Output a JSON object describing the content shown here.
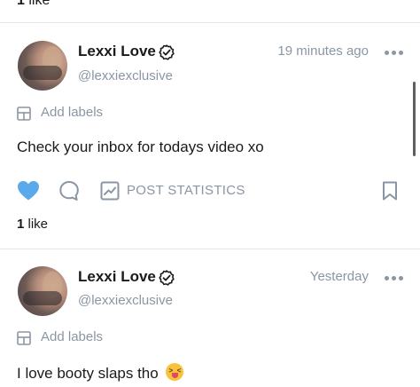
{
  "feed": {
    "previous_post_likes": {
      "count": "1",
      "label": "like"
    },
    "posts": [
      {
        "author_name": "Lexxi Love",
        "handle": "@lexxiexclusive",
        "time": "19 minutes ago",
        "add_labels": "Add labels",
        "text": "Check your inbox for todays video xo",
        "liked": true,
        "stats_label": "POST STATISTICS",
        "likes_count": "1",
        "likes_label": "like"
      },
      {
        "author_name": "Lexxi Love",
        "handle": "@lexxiexclusive",
        "time": "Yesterday",
        "add_labels": "Add labels",
        "text": "I love booty slaps tho",
        "emoji": "squinting-face-with-tongue"
      }
    ]
  },
  "colors": {
    "accent_blue": "#5aa9ea",
    "muted_text": "#8a96a3",
    "divider": "#e6e6e8",
    "body_text": "#1a1a1a"
  }
}
